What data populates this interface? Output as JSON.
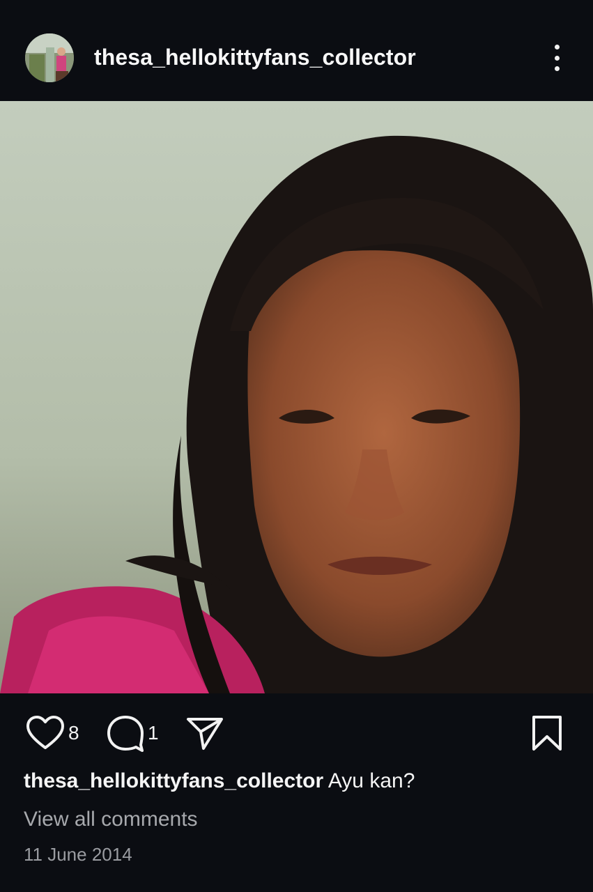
{
  "post": {
    "username": "thesa_hellokittyfans_collector",
    "likes": "8",
    "comments": "1",
    "caption_user": "thesa_hellokittyfans_collector",
    "caption_text": " Ayu kan?",
    "view_comments": "View all comments",
    "date": "11 June 2014"
  },
  "icons": {
    "more": "more-vertical-icon",
    "like": "heart-icon",
    "comment": "comment-icon",
    "share": "send-icon",
    "save": "bookmark-icon"
  },
  "colors": {
    "background": "#0b0d12",
    "text": "#f5f5f5",
    "muted": "#a7a9ad"
  }
}
